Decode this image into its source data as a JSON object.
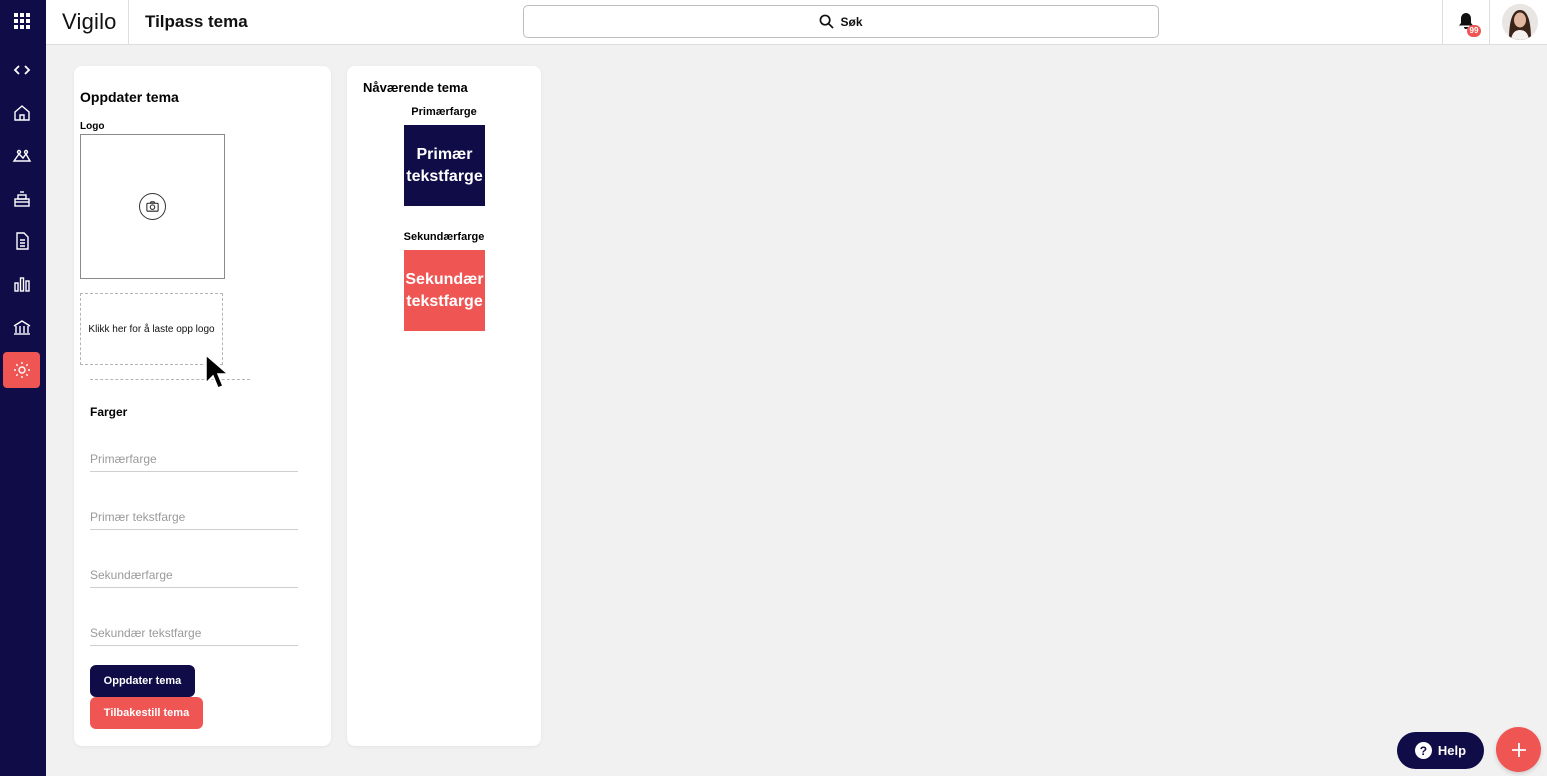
{
  "app": {
    "brand": "Vigilo",
    "page_title": "Tilpass tema"
  },
  "search": {
    "label": "Søk"
  },
  "notifications": {
    "count": "99"
  },
  "sidebar": {
    "items": [
      {
        "name": "apps-grid-icon"
      },
      {
        "name": "collapse-icon"
      },
      {
        "name": "home-icon"
      },
      {
        "name": "children-icon"
      },
      {
        "name": "groups-icon"
      },
      {
        "name": "document-icon"
      },
      {
        "name": "statistics-icon"
      },
      {
        "name": "institution-icon"
      },
      {
        "name": "settings-icon",
        "active": true
      }
    ]
  },
  "update_theme": {
    "title": "Oppdater tema",
    "logo_label": "Logo",
    "upload_text": "Klikk her for å laste opp logo",
    "colors_heading": "Farger",
    "fields": {
      "primary": {
        "placeholder": "Primærfarge",
        "value": ""
      },
      "primary_text": {
        "placeholder": "Primær tekstfarge",
        "value": ""
      },
      "secondary": {
        "placeholder": "Sekundærfarge",
        "value": ""
      },
      "secondary_text": {
        "placeholder": "Sekundær tekstfarge",
        "value": ""
      }
    },
    "update_button": "Oppdater tema",
    "reset_button": "Tilbakestill tema"
  },
  "current_theme": {
    "title": "Nåværende tema",
    "primary": {
      "label": "Primærfarge",
      "sample_line1": "Primær",
      "sample_line2": "tekstfarge",
      "color": "#0f0c48"
    },
    "secondary": {
      "label": "Sekundærfarge",
      "sample_line1": "Sekundær",
      "sample_line2": "tekstfarge",
      "color": "#ee5553"
    }
  },
  "help": {
    "label": "Help"
  },
  "colors": {
    "brand_dark": "#0f0c48",
    "accent": "#ee5553",
    "background": "#f1f1f1"
  }
}
